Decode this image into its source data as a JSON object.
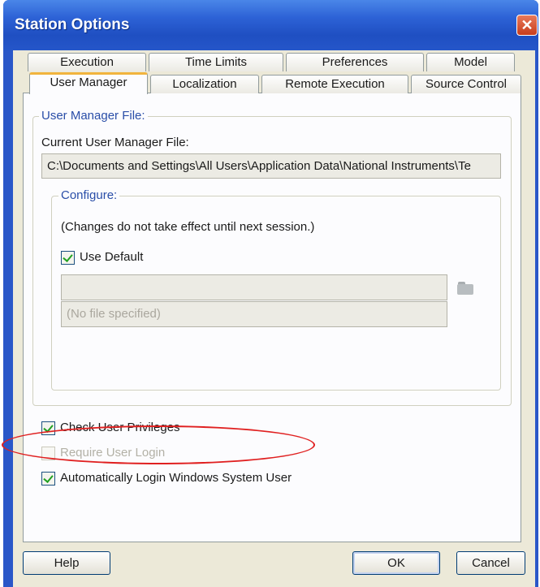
{
  "window": {
    "title": "Station Options",
    "close_symbol": "✕"
  },
  "tabs": {
    "row1": [
      "Execution",
      "Time Limits",
      "Preferences",
      "Model"
    ],
    "row2": [
      "User Manager",
      "Localization",
      "Remote Execution",
      "Source Control"
    ],
    "active": "User Manager"
  },
  "user_manager_file": {
    "group_title": "User Manager File:",
    "current_label": "Current User Manager File:",
    "current_value": "C:\\Documents and Settings\\All Users\\Application Data\\National Instruments\\Te",
    "configure": {
      "group_title": "Configure:",
      "note": "(Changes do not take effect until next session.)",
      "use_default": {
        "label": "Use Default",
        "checked": true
      },
      "path_value": "",
      "status_value": "(No file specified)",
      "browse_icon": "folder-icon"
    }
  },
  "options": {
    "check_user_privileges": {
      "label": "Check User Privileges",
      "checked": true,
      "enabled": true
    },
    "require_user_login": {
      "label": "Require User Login",
      "checked": false,
      "enabled": false
    },
    "auto_login_windows_user": {
      "label": "Automatically Login Windows System User",
      "checked": true,
      "enabled": true
    }
  },
  "buttons": {
    "help": "Help",
    "ok": "OK",
    "cancel": "Cancel"
  },
  "colors": {
    "title_bar": "#2556c9",
    "dialog_face": "#ece9d8",
    "tab_active_accent": "#f1b43e",
    "check_green": "#21a121",
    "highlight_ellipse": "#e02020"
  }
}
